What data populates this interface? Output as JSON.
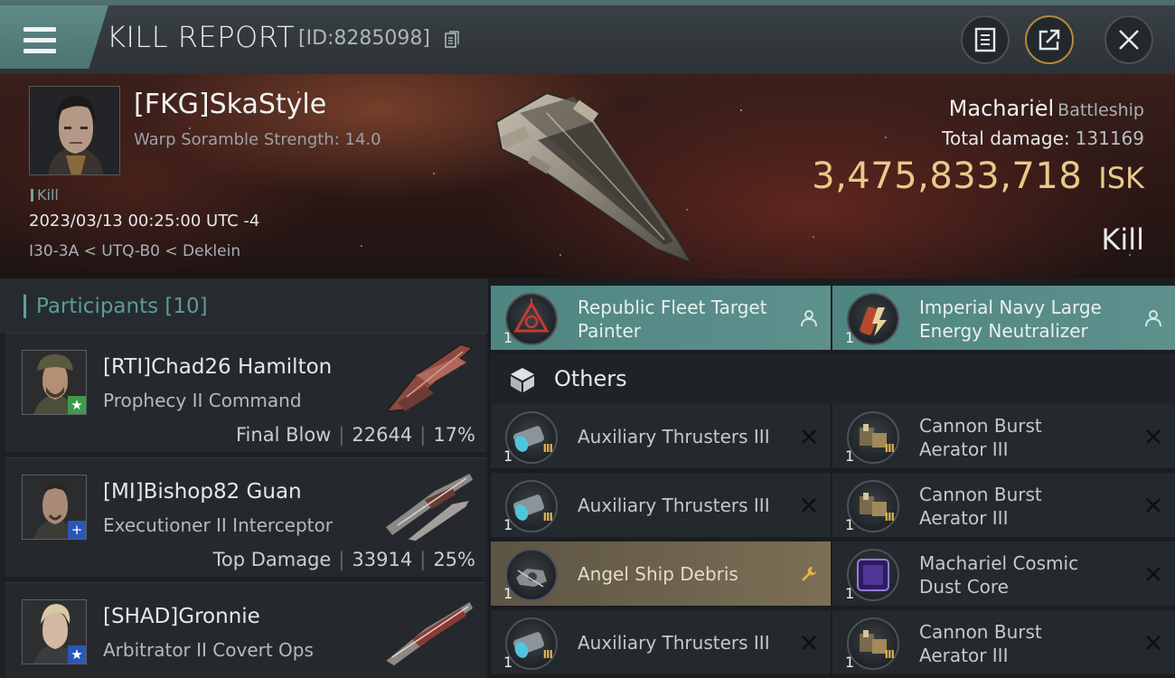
{
  "header": {
    "title": "KILL REPORT",
    "report_id": "[ID:8285098]",
    "icons": [
      "menu-icon",
      "copy-icon",
      "notes-icon",
      "share-icon",
      "close-icon"
    ]
  },
  "victim": {
    "name": "[FKG]SkaStyle",
    "scramble": "Warp Soramble Strength: 14.0",
    "tag": "Kill",
    "date": "2023/03/13 00:25:00 UTC -4",
    "route": "I30-3A < UTQ-B0 < Deklein",
    "ship_name": "Machariel",
    "ship_class": "Battleship",
    "total_damage_label": "Total damage:",
    "total_damage": "131169",
    "isk_value": "3,475,833,718",
    "isk_currency": "ISK",
    "result": "Kill"
  },
  "participants": {
    "title": "Participants [10]",
    "rows": [
      {
        "name": "[RTI]Chad26 Hamilton",
        "ship": "Prophecy II Command",
        "stat_label": "Final Blow",
        "damage": "22644",
        "percent": "17%",
        "badge": "star-icon"
      },
      {
        "name": "[MI]Bishop82 Guan",
        "ship": "Executioner II Interceptor",
        "stat_label": "Top Damage",
        "damage": "33914",
        "percent": "25%",
        "badge": "plus-icon"
      },
      {
        "name": "[SHAD]Gronnie",
        "ship": "Arbitrator II Covert Ops",
        "badge": "star-icon"
      }
    ]
  },
  "items": {
    "fitted": [
      {
        "line1": "Republic Fleet Target",
        "line2": "Painter",
        "qty": "1",
        "action": "pilot-icon"
      },
      {
        "line1": "Imperial Navy Large",
        "line2": "Energy Neutralizer",
        "qty": "1",
        "action": "pilot-icon"
      }
    ],
    "others_label": "Others",
    "others": [
      {
        "line1": "Auxiliary Thrusters III",
        "line2": "",
        "qty": "1",
        "tier": "III",
        "action": "close-icon"
      },
      {
        "line1": "Cannon Burst",
        "line2": "Aerator III",
        "qty": "1",
        "tier": "III",
        "action": "close-icon"
      },
      {
        "line1": "Auxiliary Thrusters III",
        "line2": "",
        "qty": "1",
        "tier": "III",
        "action": "close-icon"
      },
      {
        "line1": "Cannon Burst",
        "line2": "Aerator III",
        "qty": "1",
        "tier": "III",
        "action": "close-icon"
      },
      {
        "line1": "Angel Ship Debris",
        "line2": "",
        "qty": "1",
        "tier": "",
        "action": "wrench-icon"
      },
      {
        "line1": "Machariel Cosmic",
        "line2": "Dust Core",
        "qty": "1",
        "tier": "",
        "action": "close-icon"
      },
      {
        "line1": "Auxiliary Thrusters III",
        "line2": "",
        "qty": "1",
        "tier": "III",
        "action": "close-icon"
      },
      {
        "line1": "Cannon Burst",
        "line2": "Aerator III",
        "qty": "1",
        "tier": "III",
        "action": "close-icon"
      }
    ]
  },
  "colors": {
    "accent_teal": "#5e908c",
    "isk_gold": "#e9c98a",
    "salvage_gold": "#7b6f55"
  }
}
